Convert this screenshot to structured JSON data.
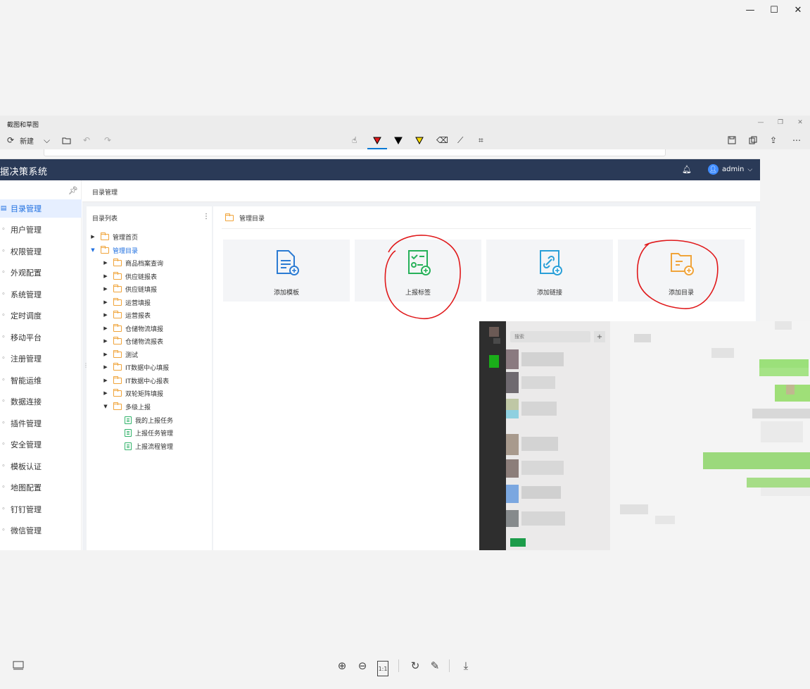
{
  "snip_app": {
    "title": "截图和草图",
    "new_label": "新建"
  },
  "app": {
    "title": "据决策系统",
    "user_name": "admin"
  },
  "sidebar": {
    "items": [
      {
        "label": "目录管理"
      },
      {
        "label": "用户管理"
      },
      {
        "label": "权限管理"
      },
      {
        "label": "外观配置"
      },
      {
        "label": "系统管理"
      },
      {
        "label": "定时调度"
      },
      {
        "label": "移动平台"
      },
      {
        "label": "注册管理"
      },
      {
        "label": "智能运维"
      },
      {
        "label": "数据连接"
      },
      {
        "label": "插件管理"
      },
      {
        "label": "安全管理"
      },
      {
        "label": "模板认证"
      },
      {
        "label": "地图配置"
      },
      {
        "label": "钉钉管理"
      },
      {
        "label": "微信管理"
      }
    ]
  },
  "breadcrumb": "目录管理",
  "tree": {
    "title": "目录列表",
    "nodes": [
      {
        "label": "管理首页"
      },
      {
        "label": "管理目录"
      },
      {
        "label": "商品档案查询"
      },
      {
        "label": "供应链报表"
      },
      {
        "label": "供应链填报"
      },
      {
        "label": "运营填报"
      },
      {
        "label": "运营报表"
      },
      {
        "label": "仓储物流填报"
      },
      {
        "label": "仓储物流报表"
      },
      {
        "label": "测试"
      },
      {
        "label": "IT数据中心填报"
      },
      {
        "label": "IT数据中心报表"
      },
      {
        "label": "双轮矩阵填报"
      },
      {
        "label": "多级上报"
      },
      {
        "label": "我的上报任务"
      },
      {
        "label": "上报任务管理"
      },
      {
        "label": "上报流程管理"
      }
    ]
  },
  "panel": {
    "title": "管理目录",
    "cards": [
      {
        "label": "添加模板",
        "icon": "add-template-icon",
        "color": "#2b7bd3"
      },
      {
        "label": "上报标签",
        "icon": "report-tag-icon",
        "color": "#27b15a"
      },
      {
        "label": "添加链接",
        "icon": "add-link-icon",
        "color": "#2a9fd8"
      },
      {
        "label": "添加目录",
        "icon": "add-folder-icon",
        "color": "#f0a43a"
      }
    ]
  },
  "chat": {
    "search_placeholder": "搜索"
  },
  "colors": {
    "header": "#2a3a57",
    "accent": "#1f6fe0",
    "annotation": "#e0191b"
  }
}
